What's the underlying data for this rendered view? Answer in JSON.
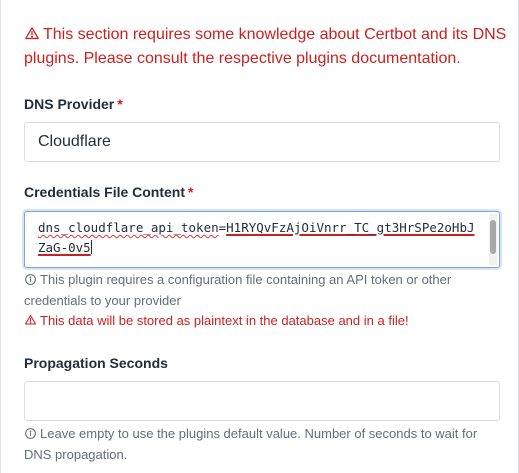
{
  "alert": {
    "icon": "warning-triangle-icon",
    "text": "This section requires some knowledge about Certbot and its DNS plugins. Please consult the respective plugins documentation.",
    "color": "#cd201f"
  },
  "dns_provider": {
    "label": "DNS Provider",
    "required_mark": "*",
    "value": "Cloudflare"
  },
  "credentials": {
    "label": "Credentials File Content",
    "required_mark": "*",
    "key_part": "dns_cloudflare_api_token",
    "equals": "=",
    "token_part": "H1RYQvFzAjOiVnrr_TC_gt3HrSPe2oHbJZaG-0v5",
    "help_icon": "info-circle-icon",
    "help_text": "This plugin requires a configuration file containing an API token or other credentials to your provider",
    "danger_icon": "warning-triangle-icon",
    "danger_text": "This data will be stored as plaintext in the database and in a file!"
  },
  "propagation": {
    "label": "Propagation Seconds",
    "value": "",
    "help_icon": "info-circle-icon",
    "help_text": "Leave empty to use the plugins default value. Number of seconds to wait for DNS propagation."
  },
  "colors": {
    "danger": "#cd201f",
    "muted": "#656d77",
    "text": "#232e3c",
    "focus_border": "#7aa7e0"
  }
}
